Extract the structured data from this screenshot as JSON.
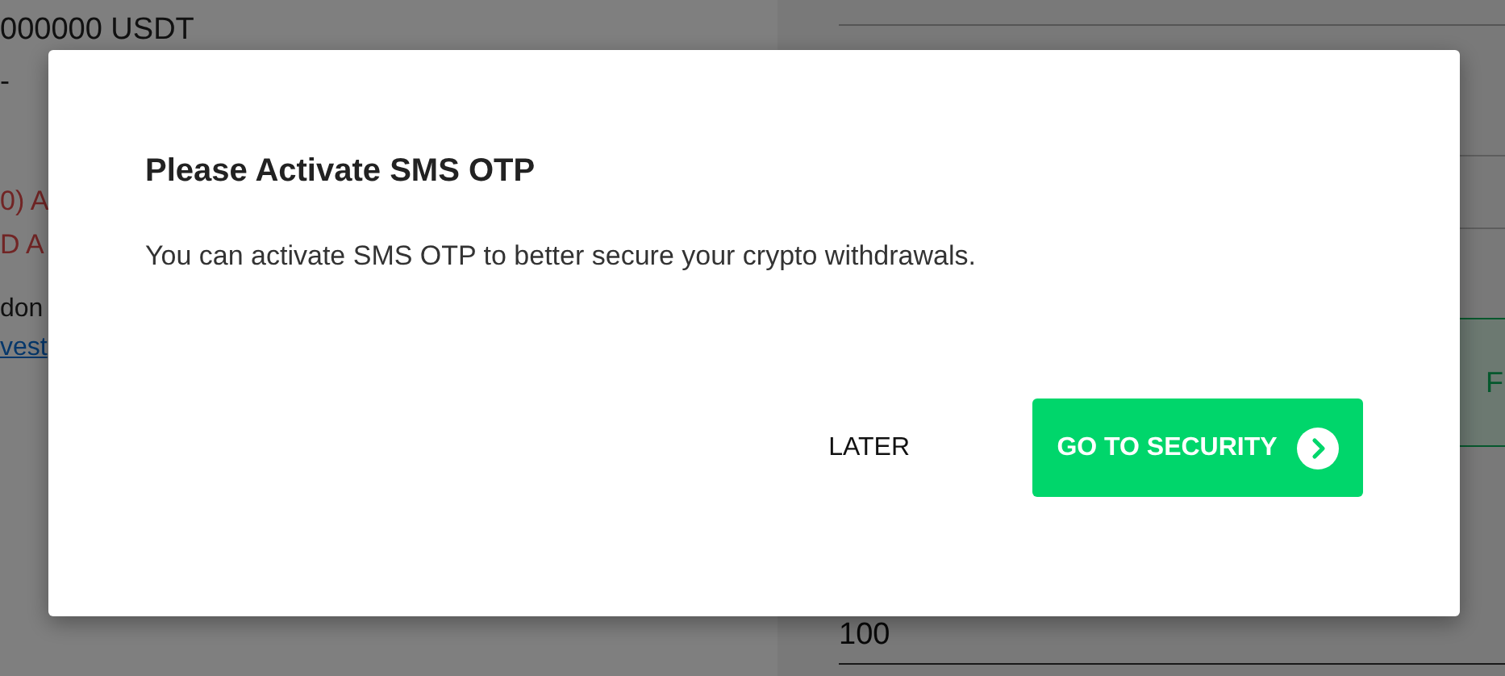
{
  "page": {
    "balance": "000000 USDT",
    "dash": "-",
    "warning_lines": [
      "0) A",
      "D A"
    ],
    "note": "don",
    "link": "vest",
    "green_button_fragment": "F",
    "amount": "100"
  },
  "dialog": {
    "title": "Please Activate SMS OTP",
    "message": "You can activate SMS OTP to better secure your crypto withdrawals.",
    "buttons": [
      {
        "label": "LATER",
        "kind": "text"
      },
      {
        "label": "GO TO SECURITY",
        "kind": "primary"
      }
    ]
  }
}
